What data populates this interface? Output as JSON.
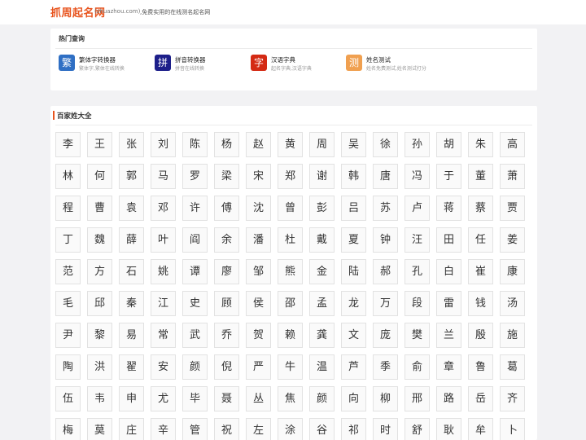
{
  "header": {
    "logo": "抓周起名网",
    "domain": "(zhuazhou.com)",
    "tagline": ",免费实用的在线测名起名网"
  },
  "hot": {
    "title": "热门查询",
    "tools": [
      {
        "icon_char": "繁",
        "icon_color": "#2f6fc4",
        "name": "繁体字转换器",
        "desc": "繁体字,繁体在线转换"
      },
      {
        "icon_char": "拼",
        "icon_color": "#1d1f8a",
        "name": "拼音转换器",
        "desc": "拼音在线转换"
      },
      {
        "icon_char": "字",
        "icon_color": "#d42a14",
        "name": "汉语字典",
        "desc": "起名字典,汉语字典"
      },
      {
        "icon_char": "测",
        "icon_color": "#f0a050",
        "name": "姓名测试",
        "desc": "姓名免费测试,姓名测试打分"
      }
    ]
  },
  "surnames": {
    "title": "百家姓大全",
    "items": [
      "李",
      "王",
      "张",
      "刘",
      "陈",
      "杨",
      "赵",
      "黄",
      "周",
      "吴",
      "徐",
      "孙",
      "胡",
      "朱",
      "高",
      "林",
      "何",
      "郭",
      "马",
      "罗",
      "梁",
      "宋",
      "郑",
      "谢",
      "韩",
      "唐",
      "冯",
      "于",
      "董",
      "萧",
      "程",
      "曹",
      "袁",
      "邓",
      "许",
      "傅",
      "沈",
      "曾",
      "彭",
      "吕",
      "苏",
      "卢",
      "蒋",
      "蔡",
      "贾",
      "丁",
      "魏",
      "薛",
      "叶",
      "阎",
      "余",
      "潘",
      "杜",
      "戴",
      "夏",
      "钟",
      "汪",
      "田",
      "任",
      "姜",
      "范",
      "方",
      "石",
      "姚",
      "谭",
      "廖",
      "邹",
      "熊",
      "金",
      "陆",
      "郝",
      "孔",
      "白",
      "崔",
      "康",
      "毛",
      "邱",
      "秦",
      "江",
      "史",
      "顾",
      "侯",
      "邵",
      "孟",
      "龙",
      "万",
      "段",
      "雷",
      "钱",
      "汤",
      "尹",
      "黎",
      "易",
      "常",
      "武",
      "乔",
      "贺",
      "赖",
      "龚",
      "文",
      "庞",
      "樊",
      "兰",
      "殷",
      "施",
      "陶",
      "洪",
      "翟",
      "安",
      "颜",
      "倪",
      "严",
      "牛",
      "温",
      "芦",
      "季",
      "俞",
      "章",
      "鲁",
      "葛",
      "伍",
      "韦",
      "申",
      "尤",
      "毕",
      "聂",
      "丛",
      "焦",
      "颜",
      "向",
      "柳",
      "邢",
      "路",
      "岳",
      "齐",
      "梅",
      "莫",
      "庄",
      "辛",
      "管",
      "祝",
      "左",
      "涂",
      "谷",
      "祁",
      "时",
      "舒",
      "耿",
      "牟",
      "卜"
    ]
  }
}
